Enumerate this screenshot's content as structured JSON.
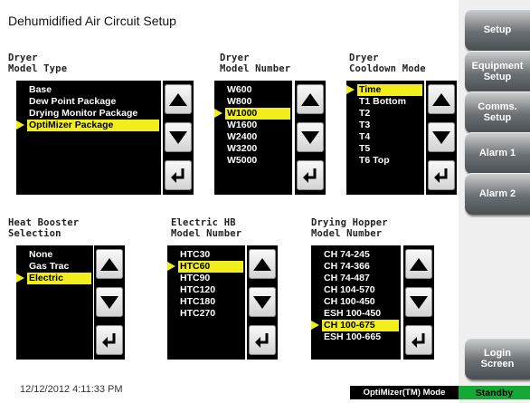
{
  "title": "Dehumidified Air Circuit Setup",
  "sections": {
    "dryer_model_type": {
      "label": [
        "Dryer",
        "Model Type"
      ],
      "options": [
        "Base",
        "Dew Point Package",
        "Drying Monitor Package",
        "OptiMizer Package"
      ],
      "selected": 3
    },
    "dryer_model_number": {
      "label": [
        "Dryer",
        "Model Number"
      ],
      "options": [
        "W600",
        "W800",
        "W1000",
        "W1600",
        "W2400",
        "W3200",
        "W5000"
      ],
      "selected": 2
    },
    "dryer_cooldown_mode": {
      "label": [
        "Dryer",
        "Cooldown Mode"
      ],
      "options": [
        "Time",
        "T1 Bottom",
        "T2",
        "T3",
        "T4",
        "T5",
        "T6 Top"
      ],
      "selected": 0
    },
    "heat_booster_selection": {
      "label": [
        "Heat Booster",
        "Selection"
      ],
      "options": [
        "None",
        "Gas Trac",
        "Electric"
      ],
      "selected": 2
    },
    "electric_hb_model_number": {
      "label": [
        "Electric HB",
        "Model Number"
      ],
      "options": [
        "HTC30",
        "HTC60",
        "HTC90",
        "HTC120",
        "HTC180",
        "HTC270"
      ],
      "selected": 1
    },
    "drying_hopper_model_number": {
      "label": [
        "Drying Hopper",
        "Model Number"
      ],
      "options": [
        "CH 74-245",
        "CH 74-366",
        "CH 74-487",
        "CH 104-570",
        "CH 100-450",
        "ESH 100-450",
        "CH 100-675",
        "ESH 100-665"
      ],
      "selected": 6
    }
  },
  "icons": {
    "up": "arrow-up-icon",
    "down": "arrow-down-icon",
    "enter": "enter-icon"
  },
  "sidebar": [
    {
      "label": "Setup",
      "name": "setup-button"
    },
    {
      "label": "Equipment Setup",
      "name": "equipment-setup-button"
    },
    {
      "label": "Comms. Setup",
      "name": "comms-setup-button"
    },
    {
      "label": "Alarm 1",
      "name": "alarm-1-button"
    },
    {
      "label": "Alarm 2",
      "name": "alarm-2-button"
    },
    {
      "label": "Login Screen",
      "name": "login-screen-button"
    }
  ],
  "status": {
    "datetime": "12/12/2012 4:11:33 PM",
    "mode": "OptiMizer(TM) Mode",
    "state": "Standby"
  },
  "colors": {
    "selection": "#f2ee1c",
    "standby": "#16a834",
    "list_bg": "#000000"
  }
}
